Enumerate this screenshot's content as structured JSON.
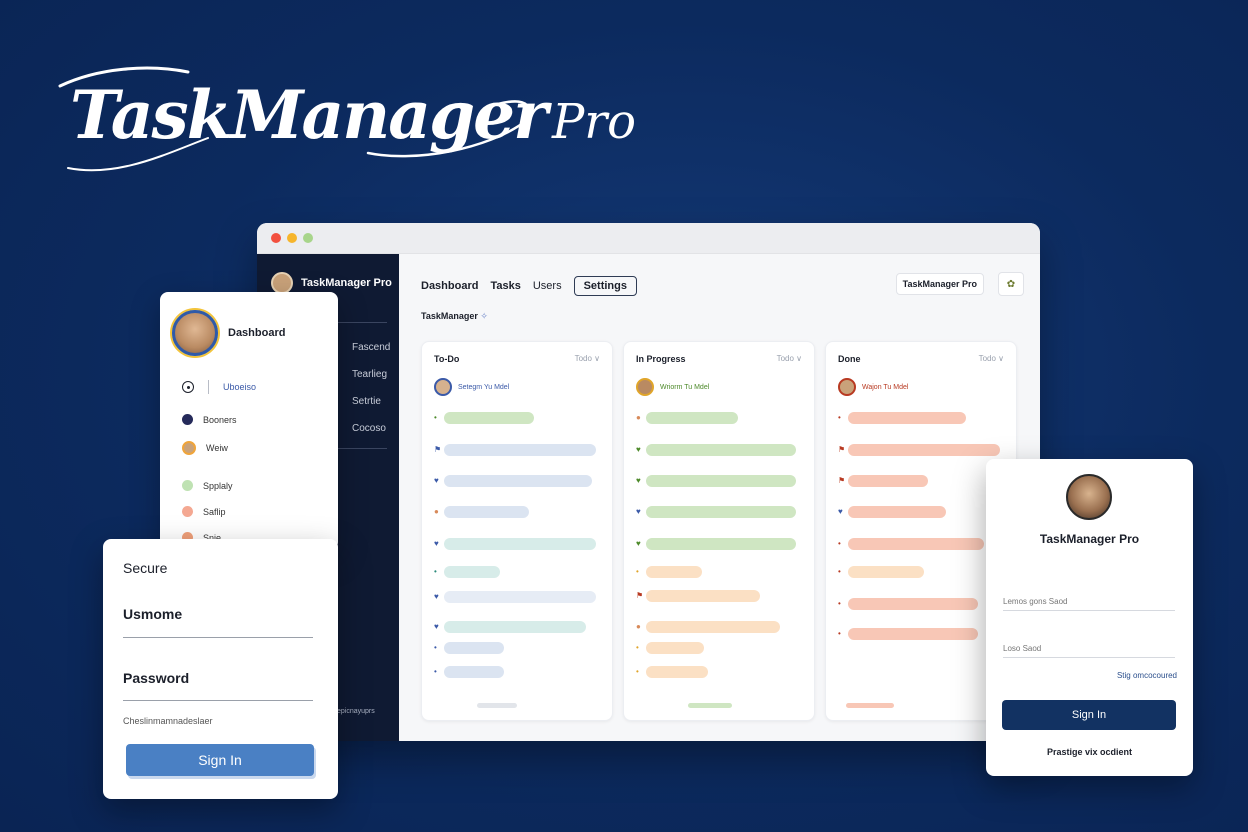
{
  "logo": {
    "main": "TaskManager",
    "suffix": "Pro"
  },
  "browser": {
    "sidebar": {
      "brand": "TaskManager Pro",
      "links": [
        "Fascend",
        "Tearlieg",
        "Setrtie",
        "Cocoso"
      ],
      "footer": "epicnayuprs"
    },
    "topnav": {
      "items": [
        "Dashboard",
        "Tasks",
        "Users",
        "Settings"
      ],
      "active": "Settings",
      "right_button": "TaskManager Pro",
      "right_icon": "colorful-badge-icon"
    },
    "section_title": "TaskManager",
    "columns": [
      {
        "title": "To-Do",
        "option": "Todo ∨",
        "assignee": "Setegm Yu Mdel",
        "accent": "#3b5aa8"
      },
      {
        "title": "In Progress",
        "option": "Todo ∨",
        "assignee": "Wriorm Tu Mdel",
        "accent": "#4d8a2a"
      },
      {
        "title": "Done",
        "option": "Todo ∨",
        "assignee": "Wajon Tu Mdel",
        "accent": "#b83a22"
      }
    ],
    "colors": {
      "green": "#cfe6c2",
      "blue": "#dbe4f1",
      "teal": "#d7ece9",
      "orange": "#fbe0c4",
      "salmon": "#f8c7b6"
    }
  },
  "left_card": {
    "title": "Dashboard",
    "items": [
      "Uboeiso",
      "Booners",
      "Weiw",
      "Spplaly",
      "Saflip",
      "Snie"
    ]
  },
  "secure_card": {
    "title": "Secure",
    "username_label": "Usmome",
    "password_label": "Password",
    "hint": "Cheslinmamnadeslaer",
    "button": "Sign In"
  },
  "right_card": {
    "title": "TaskManager Pro",
    "field1": "Lemos gons Saod",
    "field2": "Loso Saod",
    "link": "Stig omcocoured",
    "button": "Sign In",
    "footer": "Prastige vix ocdient"
  }
}
